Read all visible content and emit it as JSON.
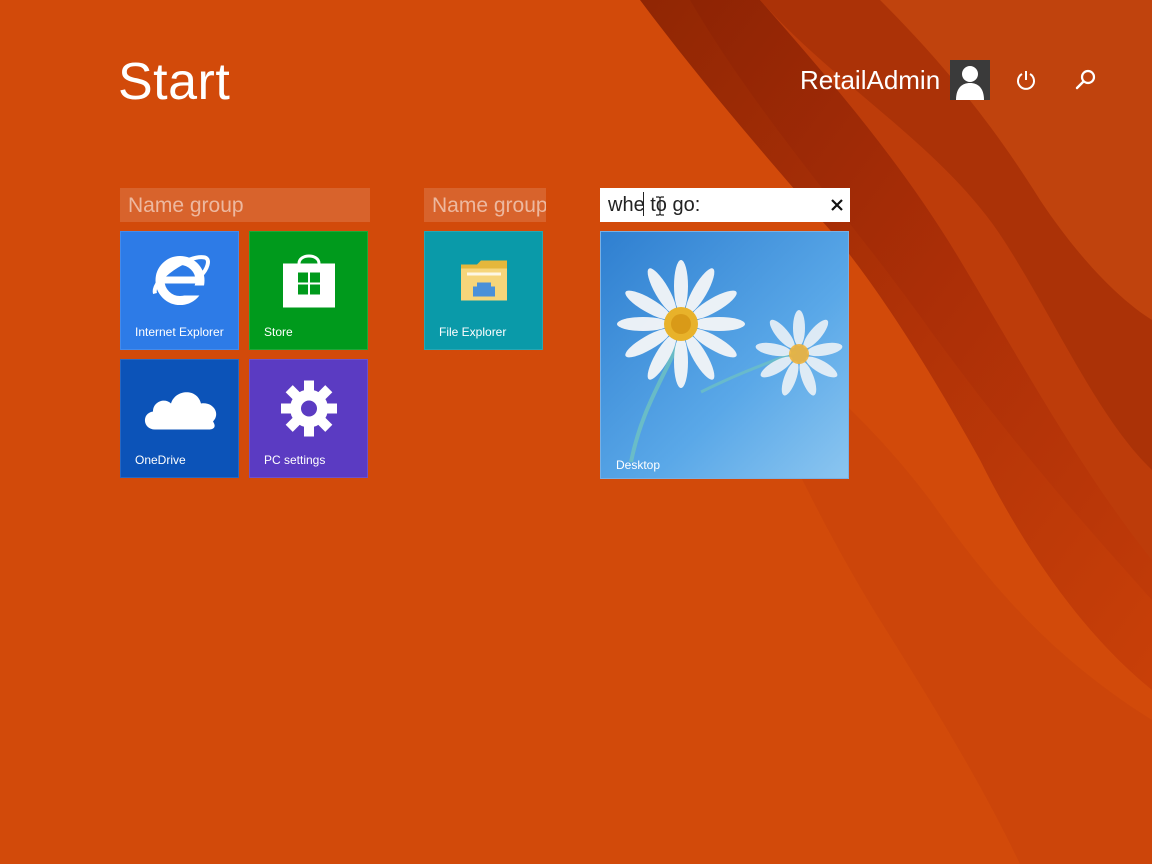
{
  "screen": {
    "title": "Start",
    "background_color": "#d24a0a"
  },
  "user": {
    "name": "RetailAdmin",
    "avatar_icon": "user-silhouette-icon"
  },
  "top_actions": {
    "power_icon": "power-icon",
    "search_icon": "search-icon"
  },
  "groups": [
    {
      "placeholder": "Name group",
      "tiles": [
        {
          "label": "Internet Explorer",
          "color": "#2d7be7",
          "icon": "internet-explorer-icon"
        },
        {
          "label": "Store",
          "color": "#009a1c",
          "icon": "store-icon"
        },
        {
          "label": "OneDrive",
          "color": "#0c53b8",
          "icon": "onedrive-icon"
        },
        {
          "label": "PC settings",
          "color": "#5b3bc2",
          "icon": "gear-icon"
        }
      ]
    },
    {
      "placeholder": "Name group",
      "tiles": [
        {
          "label": "File Explorer",
          "color": "#0a9aa9",
          "icon": "folder-icon"
        }
      ]
    },
    {
      "editing_value": "whe to go:",
      "clear_icon": "close-icon",
      "tiles": [
        {
          "label": "Desktop",
          "color": "#3f8fd8",
          "icon": "desktop-wallpaper"
        }
      ]
    }
  ]
}
